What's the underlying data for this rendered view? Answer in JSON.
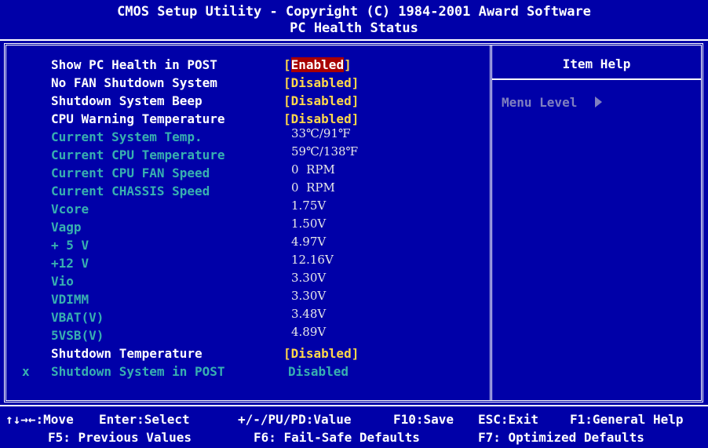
{
  "header": {
    "title": "CMOS Setup Utility - Copyright (C) 1984-2001 Award Software",
    "subtitle": "PC Health Status"
  },
  "settings": [
    {
      "label": "Show PC Health in POST",
      "open": "[",
      "value": "Enabled",
      "close": "]"
    },
    {
      "label": "No FAN Shutdown System",
      "value": "[Disabled]"
    },
    {
      "label": "Shutdown System Beep",
      "value": "[Disabled]"
    },
    {
      "label": "CPU Warning Temperature",
      "value": "[Disabled]"
    }
  ],
  "readings": [
    {
      "label": "Current System Temp.",
      "value": "33℃/91℉"
    },
    {
      "label": "Current CPU Temperature",
      "value": "59℃/138℉"
    },
    {
      "label": "Current CPU FAN Speed",
      "value": "0  RPM"
    },
    {
      "label": "Current CHASSIS Speed",
      "value": "0  RPM"
    },
    {
      "label": "Vcore",
      "value": "1.75V"
    },
    {
      "label": "Vagp",
      "value": "1.50V"
    },
    {
      "label": "+ 5 V",
      "value": "4.97V"
    },
    {
      "label": "+12 V",
      "value": "12.16V"
    },
    {
      "label": "Vio",
      "value": "3.30V"
    },
    {
      "label": "VDIMM",
      "value": "3.30V"
    },
    {
      "label": "VBAT(V)",
      "value": "3.48V"
    },
    {
      "label": "5VSB(V)",
      "value": "4.89V"
    }
  ],
  "shutdown_temp": {
    "label": "Shutdown Temperature",
    "value": "[Disabled]"
  },
  "shutdown_post": {
    "marker": "x",
    "label": "Shutdown System in POST",
    "value": "Disabled"
  },
  "help": {
    "title": "Item Help",
    "menu_level": "Menu Level"
  },
  "footer": {
    "move": "↑↓→←:Move",
    "select": "Enter:Select",
    "value": "+/-/PU/PD:Value",
    "save": "F10:Save",
    "exit": "ESC:Exit",
    "general_help": "F1:General Help",
    "previous": "F5: Previous Values",
    "failsafe": "F6: Fail-Safe Defaults",
    "optimized": "F7: Optimized Defaults"
  },
  "colors": {
    "background": "#0000a8",
    "highlight": "#a80000",
    "value_yellow": "#ffd84a",
    "disabled_cyan": "#38b0b0"
  }
}
